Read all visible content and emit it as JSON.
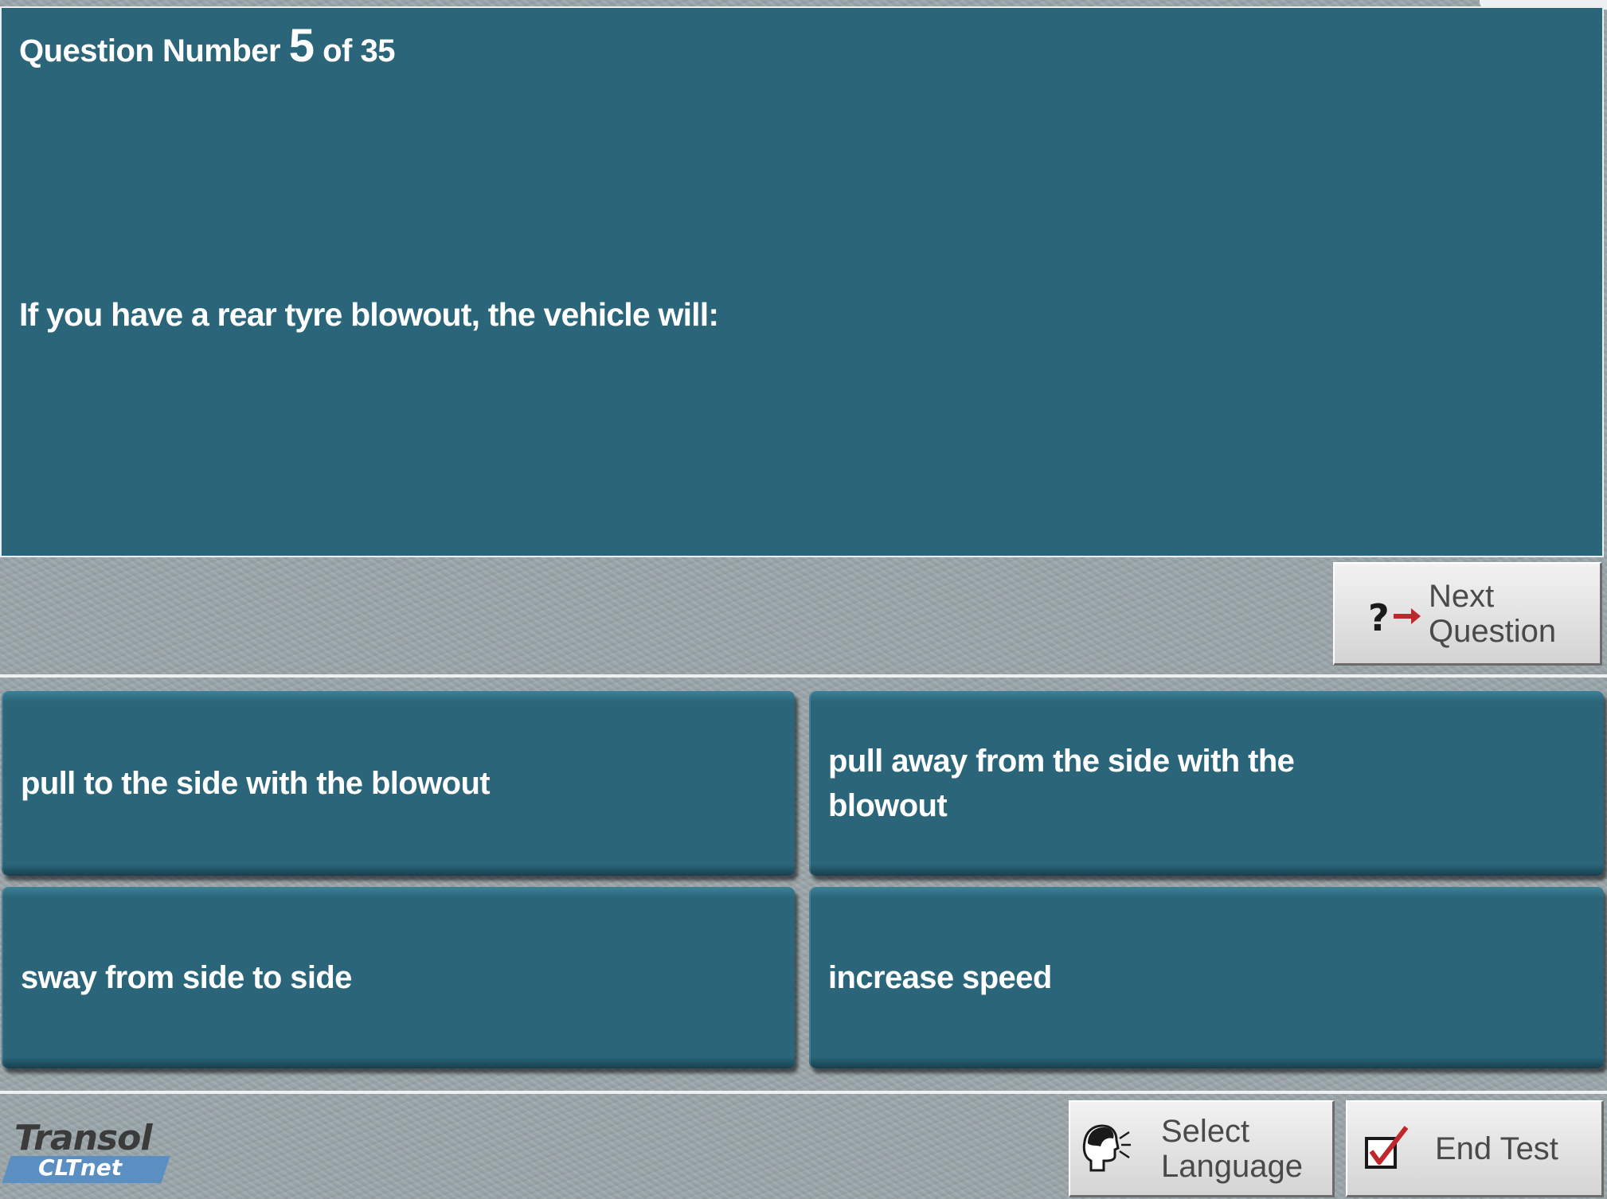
{
  "question": {
    "label": "Question Number",
    "number": "5",
    "of_label": "of 35",
    "text": "If you have a rear tyre blowout, the vehicle will:"
  },
  "nav": {
    "next_label_line1": "Next",
    "next_label_line2": "Question",
    "select_language_line1": "Select",
    "select_language_line2": "Language",
    "end_test_label": "End Test"
  },
  "answers": [
    "pull to the side with the blowout",
    "pull away from the side with the blowout",
    "sway from side to side",
    "increase speed"
  ],
  "logo": {
    "brand": "Transol",
    "product": "CLTnet"
  },
  "icons": {
    "next": "question-arrow-icon",
    "language": "speaking-head-icon",
    "end": "checkbox-tick-icon"
  },
  "colors": {
    "panel": "#2a6579",
    "background": "#9aa5a9",
    "arrow": "#c0272d",
    "tick": "#c0272d"
  }
}
